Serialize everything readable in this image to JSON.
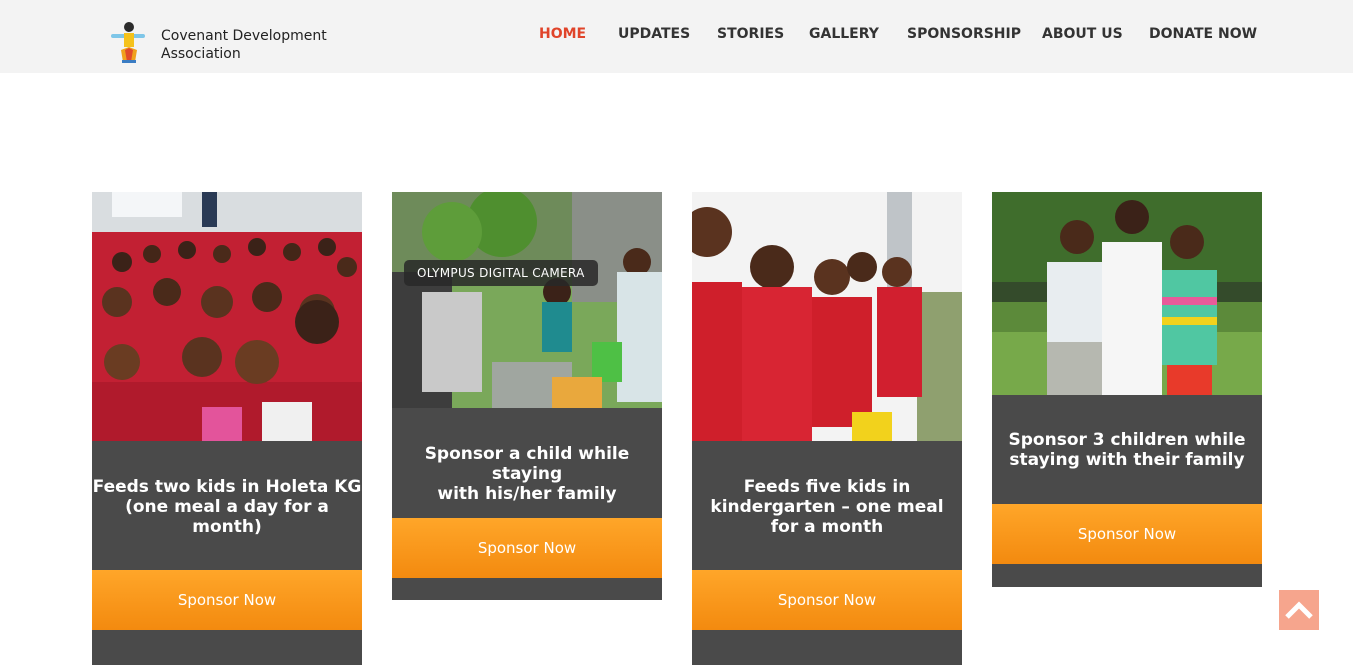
{
  "site": {
    "name_line1": "Covenant Development",
    "name_line2": "Association",
    "logo_icon": "child-figure-logo"
  },
  "nav": [
    {
      "label": "HOME",
      "active": true
    },
    {
      "label": "UPDATES"
    },
    {
      "label": "STORIES"
    },
    {
      "label": "GALLERY"
    },
    {
      "label": "SPONSORSHIP"
    },
    {
      "label": "ABOUT US"
    },
    {
      "label": "DONATE NOW"
    }
  ],
  "colors": {
    "accent": "#e0442a",
    "header_bg": "#f3f3f3",
    "card_bg": "#4a4a4a",
    "button_orange": "#f89a1c",
    "scroll_top_bg": "#f6a58d"
  },
  "cards": [
    {
      "title_lines": [
        "Feeds two kids in Holeta KG",
        "(one meal a day for a",
        "month)"
      ],
      "button": "Sponsor Now",
      "image": "children-in-red-uniforms-group"
    },
    {
      "title_lines": [
        "Sponsor a child while staying",
        "with his/her family"
      ],
      "button": "Sponsor Now",
      "image": "family-sitting-on-grass",
      "caption": "OLYMPUS DIGITAL CAMERA"
    },
    {
      "title_lines": [
        "Feeds five kids in",
        "kindergarten – one meal",
        "for a month"
      ],
      "button": "Sponsor Now",
      "image": "kindergarten-kids-sitting"
    },
    {
      "title_lines": [
        "Sponsor 3 children while",
        "staying with their family"
      ],
      "button": "Sponsor Now",
      "image": "three-girls-outdoors"
    }
  ],
  "scroll_top_icon": "chevron-up-icon"
}
